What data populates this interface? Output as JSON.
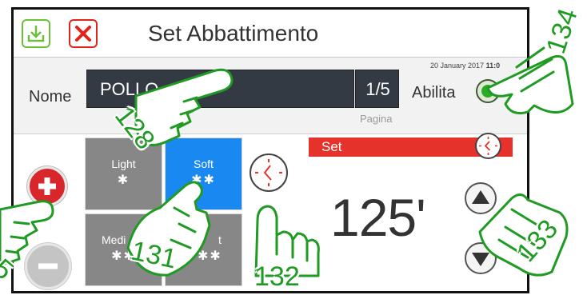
{
  "header": {
    "title": "Set Abbattimento"
  },
  "toolbar": {
    "download_icon": "download-icon",
    "close_icon": "close-icon"
  },
  "form": {
    "name_label": "Nome",
    "name_value": "POLLO",
    "page_indicator": "1/5",
    "page_label": "Pagina",
    "enable_label": "Abilita",
    "date": "20 January 2017",
    "time": "11:0"
  },
  "modes": [
    {
      "label": "Light",
      "stars": "✱",
      "selected": false
    },
    {
      "label": "Soft",
      "stars": "✱✱",
      "selected": true
    },
    {
      "label": "Medi",
      "stars": "✱✱",
      "selected": false
    },
    {
      "label": "t",
      "stars": "✱✱",
      "selected": false
    }
  ],
  "set_panel": {
    "label": "Set",
    "value": "125'"
  },
  "callouts": [
    "128",
    "131",
    "132",
    "133",
    "134",
    "5"
  ],
  "colors": {
    "accent_red": "#e5322b",
    "soft_blue": "#1989f1",
    "mode_gray": "#878787",
    "enable_green": "#2eab25",
    "callout_green": "#1f9a22",
    "dark_field": "#333a44"
  }
}
